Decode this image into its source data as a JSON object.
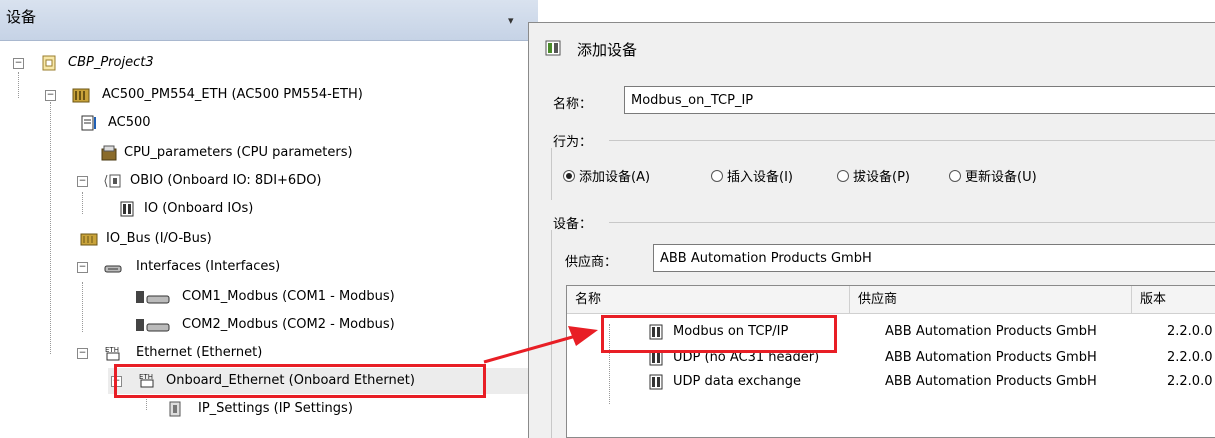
{
  "left_panel": {
    "title": "设备",
    "pin_glyph": "▾",
    "tree": [
      {
        "label": "CBP_Project3",
        "icon": "project-icon",
        "expander": "−"
      },
      {
        "label": "AC500_PM554_ETH (AC500 PM554-ETH)",
        "icon": "plc-icon",
        "expander": "−"
      },
      {
        "label": "AC500",
        "icon": "application-icon",
        "expander": ""
      },
      {
        "label": "CPU_parameters (CPU parameters)",
        "icon": "cpu-parameters-icon",
        "expander": ""
      },
      {
        "label": "OBIO (Onboard IO: 8DI+6DO)",
        "icon": "io-module-icon",
        "expander": "−"
      },
      {
        "label": "IO (Onboard IOs)",
        "icon": "io-icon",
        "expander": ""
      },
      {
        "label": "IO_Bus (I/O-Bus)",
        "icon": "io-bus-icon",
        "expander": ""
      },
      {
        "label": "Interfaces (Interfaces)",
        "icon": "interfaces-icon",
        "expander": "−"
      },
      {
        "label": "COM1_Modbus (COM1 - Modbus)",
        "icon": "serial-port-icon",
        "expander": ""
      },
      {
        "label": "COM2_Modbus (COM2 - Modbus)",
        "icon": "serial-port-icon",
        "expander": ""
      },
      {
        "label": "Ethernet (Ethernet)",
        "icon": "ethernet-icon",
        "expander": "−"
      },
      {
        "label": "Onboard_Ethernet (Onboard Ethernet)",
        "icon": "ethernet-icon",
        "expander": "−"
      },
      {
        "label": "IP_Settings (IP Settings)",
        "icon": "settings-device-icon",
        "expander": ""
      }
    ]
  },
  "dialog": {
    "title": "添加设备",
    "name_label": "名称：",
    "name_value": "Modbus_on_TCP_IP",
    "action_group_label": "行为：",
    "actions": [
      {
        "label": "添加设备(A)",
        "selected": true
      },
      {
        "label": "插入设备(I)",
        "selected": false
      },
      {
        "label": "拔设备(P)",
        "selected": false
      },
      {
        "label": "更新设备(U)",
        "selected": false
      }
    ],
    "device_group_label": "设备：",
    "vendor_label": "供应商：",
    "vendor_value": "ABB Automation Products GmbH",
    "table": {
      "columns": [
        "名称",
        "供应商",
        "版本"
      ],
      "rows": [
        {
          "name": "Modbus on TCP/IP",
          "vendor": "ABB Automation Products GmbH",
          "version": "2.2.0.0"
        },
        {
          "name": "UDP (no AC31 header)",
          "vendor": "ABB Automation Products GmbH",
          "version": "2.2.0.0"
        },
        {
          "name": "UDP data exchange",
          "vendor": "ABB Automation Products GmbH",
          "version": "2.2.0.0"
        }
      ]
    }
  },
  "colors": {
    "highlight": "#e81e25",
    "panel_header": "#c6d3e6",
    "dialog_bg": "#f0f0f0"
  }
}
